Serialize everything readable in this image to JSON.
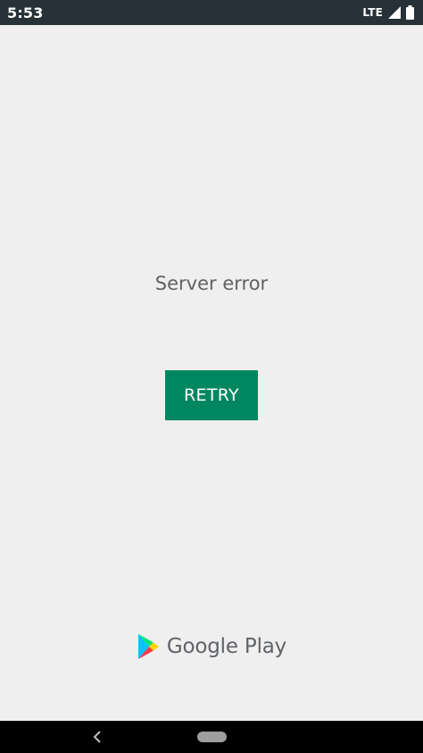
{
  "status_bar": {
    "time": "5:53",
    "network": "LTE",
    "icons": [
      "signal-icon",
      "battery-icon"
    ]
  },
  "main": {
    "error_message": "Server error",
    "retry_label": "RETRY"
  },
  "brand": {
    "name": "Google Play",
    "icon": "google-play-logo"
  },
  "nav_bar": {
    "icons": [
      "back-icon",
      "home-pill-icon"
    ]
  },
  "colors": {
    "status_bar": "#263238",
    "background": "#efefef",
    "button": "#01875f",
    "error_text": "#616161",
    "brand_text": "#5f6368",
    "nav_bar": "#000000"
  }
}
